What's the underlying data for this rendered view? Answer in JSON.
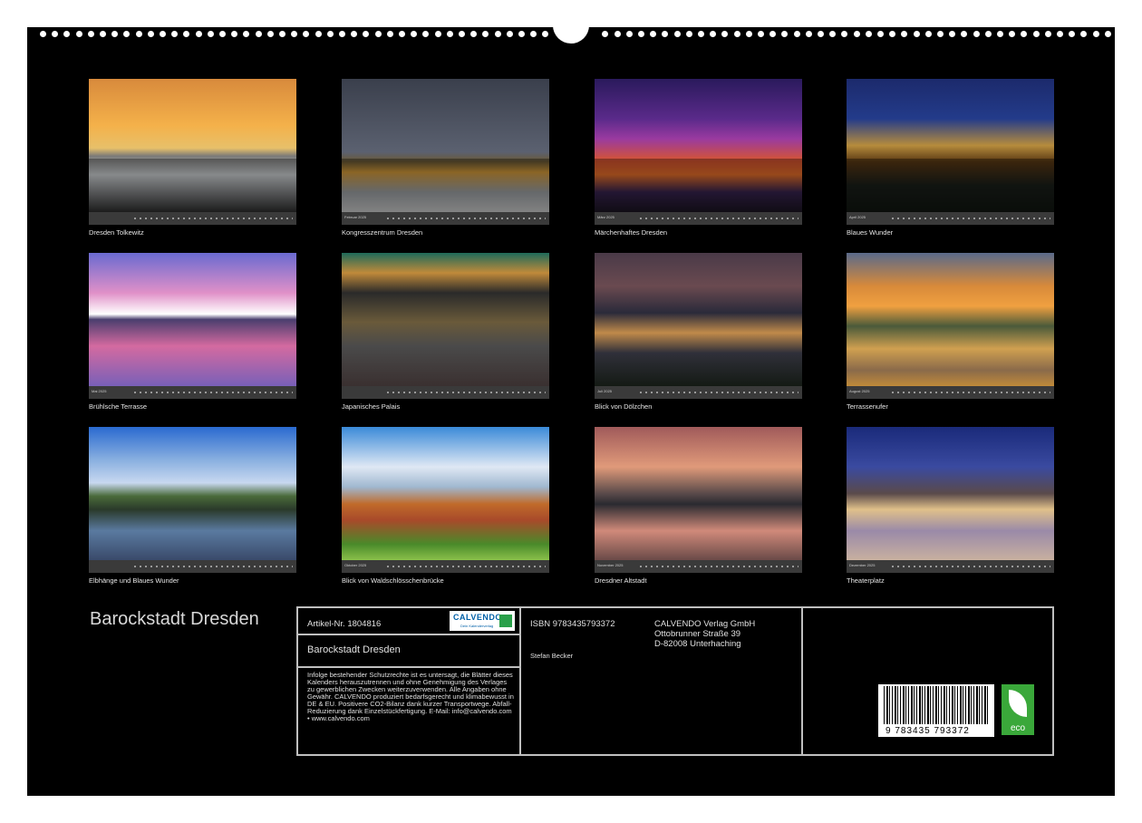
{
  "calendar": {
    "title": "Barockstadt Dresden",
    "tiles": [
      {
        "caption": "Dresden Tolkewitz",
        "month": ""
      },
      {
        "caption": "Kongresszentrum Dresden",
        "month": "Februar 2025"
      },
      {
        "caption": "Märchenhaftes Dresden",
        "month": "März 2025"
      },
      {
        "caption": "Blaues Wunder",
        "month": "April 2025"
      },
      {
        "caption": "Brühlsche Terrasse",
        "month": "Mai 2025"
      },
      {
        "caption": "Japanisches Palais",
        "month": ""
      },
      {
        "caption": "Blick von Dölzchen",
        "month": "Juli 2025"
      },
      {
        "caption": "Terrassenufer",
        "month": "August 2025"
      },
      {
        "caption": "Elbhänge und Blaues Wunder",
        "month": ""
      },
      {
        "caption": "Blick von Waldschlösschenbrücke",
        "month": "Oktober 2025"
      },
      {
        "caption": "Dresdner Altstadt",
        "month": "November 2025"
      },
      {
        "caption": "Theaterplatz",
        "month": "Dezember 2025"
      }
    ]
  },
  "info": {
    "article": "Artikel-Nr. 1804816",
    "logo_text": "CALVENDO",
    "logo_sub": "Dein Kalenderverlag",
    "title": "Barockstadt Dresden",
    "legal": "Infolge bestehender Schutzrechte ist es untersagt, die Blätter dieses Kalenders herauszutrennen und ohne Genehmigung des Verlages zu gewerblichen Zwecken weiterzuverwenden. Alle Angaben ohne Gewähr. CALVENDO produziert bedarfsgerecht und klimabewusst in DE & EU. Positivere CO2-Bilanz dank kurzer Transportwege. Abfall-Reduzierung dank Einzelstückfertigung. E-Mail: info@calvendo.com • www.calvendo.com",
    "isbn": "ISBN 9783435793372",
    "author": "Stefan Becker",
    "publisher": [
      "CALVENDO Verlag GmbH",
      "Ottobrunner Straße 39",
      "D-82008 Unterhaching"
    ],
    "barcode_number": "9 783435 793372",
    "eco_label": "eco"
  },
  "colors": {
    "background": "#000000",
    "border": "#bfbfbf",
    "text": "#e0e0e0"
  }
}
